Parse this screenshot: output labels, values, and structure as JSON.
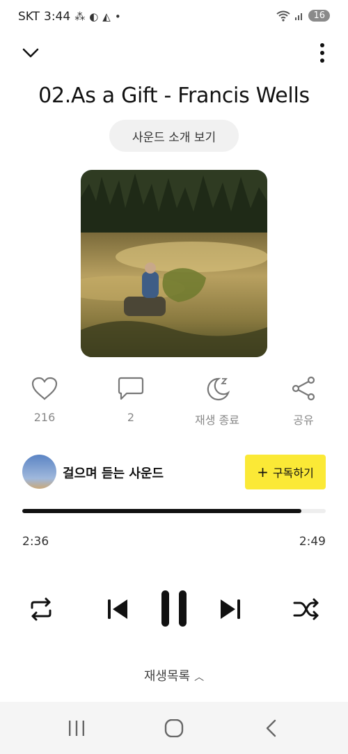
{
  "status_bar": {
    "carrier": "SKT",
    "time": "3:44",
    "battery": "16"
  },
  "track": {
    "title": "02.As a Gift - Francis Wells",
    "intro_label": "사운드 소개 보기"
  },
  "actions": {
    "like_count": "216",
    "comment_count": "2",
    "sleep_timer_label": "재생 종료",
    "share_label": "공유"
  },
  "channel": {
    "name": "걸으며 듣는 사운드",
    "subscribe_label": "구독하기"
  },
  "progress": {
    "elapsed": "2:36",
    "total": "2:49",
    "fraction": 0.92
  },
  "playlist": {
    "label": "재생목록"
  },
  "icons": {
    "collapse": "chevron-down-icon",
    "more": "more-vert-icon",
    "like": "heart-icon",
    "comment": "comment-icon",
    "sleep": "moon-icon",
    "share": "share-icon",
    "repeat": "repeat-icon",
    "previous": "skip-previous-icon",
    "pause": "pause-icon",
    "next": "skip-next-icon",
    "shuffle": "shuffle-icon"
  },
  "colors": {
    "subscribe_bg": "#fbe936",
    "progress_fill": "#111111"
  }
}
